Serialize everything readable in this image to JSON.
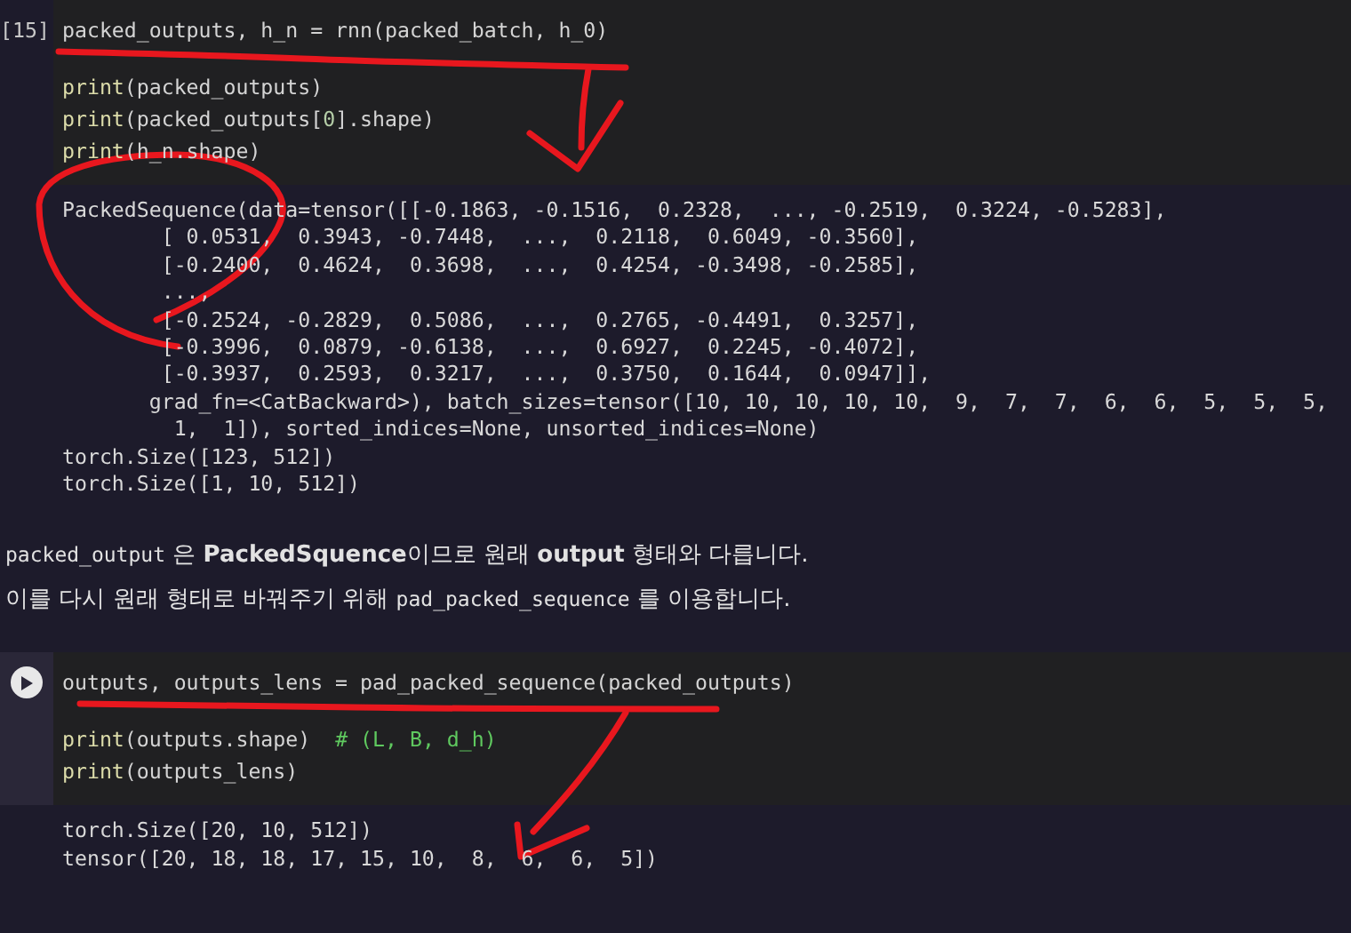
{
  "cells": [
    {
      "kind": "code",
      "gutter": {
        "kind": "count",
        "text": "[15]"
      },
      "blocks": [
        [
          [
            {
              "kind": "plain",
              "text": "packed_outputs, h_n = rnn(packed_batch, h_0)"
            }
          ]
        ],
        [
          [
            {
              "kind": "builtin",
              "text": "print"
            },
            {
              "kind": "plain",
              "text": "(packed_outputs)"
            }
          ],
          [
            {
              "kind": "builtin",
              "text": "print"
            },
            {
              "kind": "plain",
              "text": "(packed_outputs["
            },
            {
              "kind": "number",
              "text": "0"
            },
            {
              "kind": "plain",
              "text": "].shape)"
            }
          ],
          [
            {
              "kind": "builtin",
              "text": "print"
            },
            {
              "kind": "plain",
              "text": "(h_n.shape)"
            }
          ]
        ]
      ],
      "output": [
        "PackedSequence(data=tensor([[-0.1863, -0.1516,  0.2328,  ..., -0.2519,  0.3224, -0.5283],",
        "        [ 0.0531,  0.3943, -0.7448,  ...,  0.2118,  0.6049, -0.3560],",
        "        [-0.2400,  0.4624,  0.3698,  ...,  0.4254, -0.3498, -0.2585],",
        "        ...,",
        "        [-0.2524, -0.2829,  0.5086,  ...,  0.2765, -0.4491,  0.3257],",
        "        [-0.3996,  0.0879, -0.6138,  ...,  0.6927,  0.2245, -0.4072],",
        "        [-0.3937,  0.2593,  0.3217,  ...,  0.3750,  0.1644,  0.0947]],",
        "       grad_fn=<CatBackward>), batch_sizes=tensor([10, 10, 10, 10, 10,  9,  7,  7,  6,  6,  5,  5,  5,",
        "         1,  1]), sorted_indices=None, unsorted_indices=None)",
        "torch.Size([123, 512])",
        "torch.Size([1, 10, 512])"
      ]
    },
    {
      "kind": "markdown",
      "paragraphs": [
        [
          {
            "kind": "code",
            "text": "packed_output"
          },
          {
            "kind": "text",
            "text": " 은 "
          },
          {
            "kind": "bold",
            "text": "PackedSquence"
          },
          {
            "kind": "text",
            "text": "이므로 원래 "
          },
          {
            "kind": "bold",
            "text": "output"
          },
          {
            "kind": "text",
            "text": " 형태와 다릅니다."
          }
        ],
        [
          {
            "kind": "text",
            "text": "이를 다시 원래 형태로 바꿔주기 위해 "
          },
          {
            "kind": "code",
            "text": "pad_packed_sequence"
          },
          {
            "kind": "text",
            "text": " 를 이용합니다."
          }
        ]
      ]
    },
    {
      "kind": "code",
      "gutter": {
        "kind": "run-button"
      },
      "blocks": [
        [
          [
            {
              "kind": "plain",
              "text": "outputs, outputs_lens = pad_packed_sequence(packed_outputs)"
            }
          ]
        ],
        [
          [
            {
              "kind": "builtin",
              "text": "print"
            },
            {
              "kind": "plain",
              "text": "(outputs.shape)  "
            },
            {
              "kind": "comment",
              "text": "# (L, B, d_h)"
            }
          ],
          [
            {
              "kind": "builtin",
              "text": "print"
            },
            {
              "kind": "plain",
              "text": "(outputs_lens)"
            }
          ]
        ]
      ],
      "output": [
        "torch.Size([20, 10, 512])",
        "tensor([20, 18, 18, 17, 15, 10,  8,  6,  6,  5])"
      ]
    }
  ]
}
